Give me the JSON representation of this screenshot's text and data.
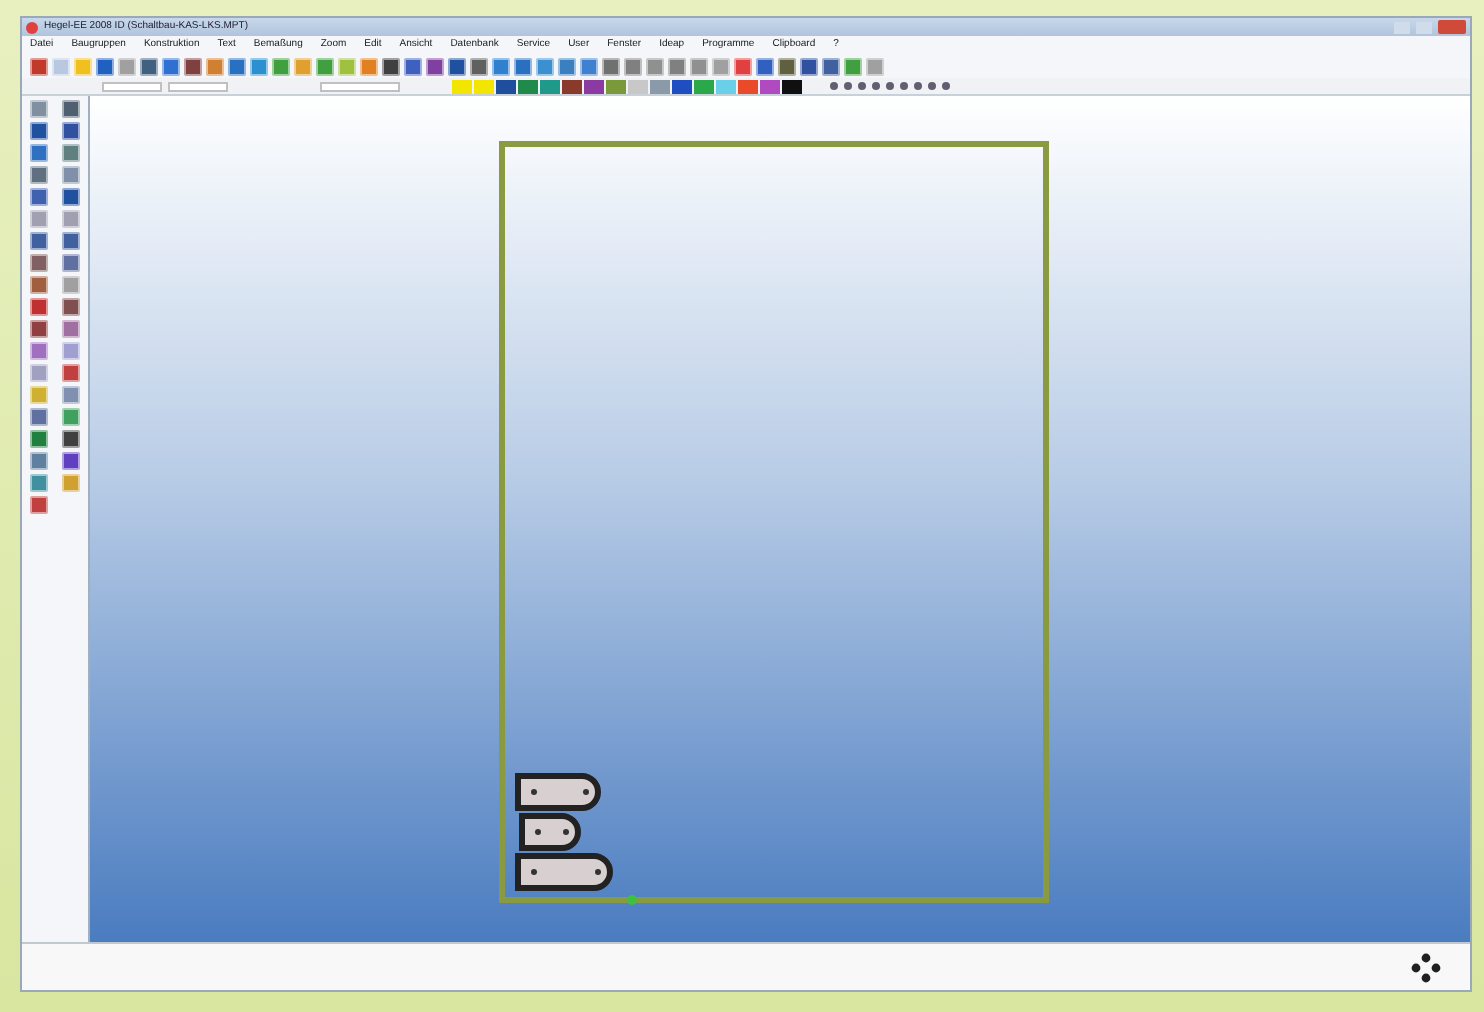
{
  "window": {
    "title": "Hegel-EE 2008 ID (Schaltbau-KAS-LKS.MPT)"
  },
  "menu": [
    "Datei",
    "Baugruppen",
    "Konstruktion",
    "Text",
    "Bemaßung",
    "Zoom",
    "Edit",
    "Ansicht",
    "Datenbank",
    "Service",
    "User",
    "Fenster",
    "Ideap",
    "Programme",
    "Clipboard",
    "?"
  ],
  "palette": [
    {
      "color": "#f2e600"
    },
    {
      "color": "#f2e600"
    },
    {
      "color": "#1f4e9c"
    },
    {
      "color": "#1f8a4a"
    },
    {
      "color": "#1f9a8a"
    },
    {
      "color": "#8a3a2a"
    },
    {
      "color": "#8a3aa0"
    },
    {
      "color": "#7a9a3a"
    },
    {
      "color": "#c8c8c8"
    },
    {
      "color": "#8a9aa8"
    },
    {
      "color": "#1f4ec0"
    },
    {
      "color": "#2aa84a"
    },
    {
      "color": "#6ad0e8"
    },
    {
      "color": "#e84a2a"
    },
    {
      "color": "#b04ac0"
    },
    {
      "color": "#101010"
    }
  ]
}
